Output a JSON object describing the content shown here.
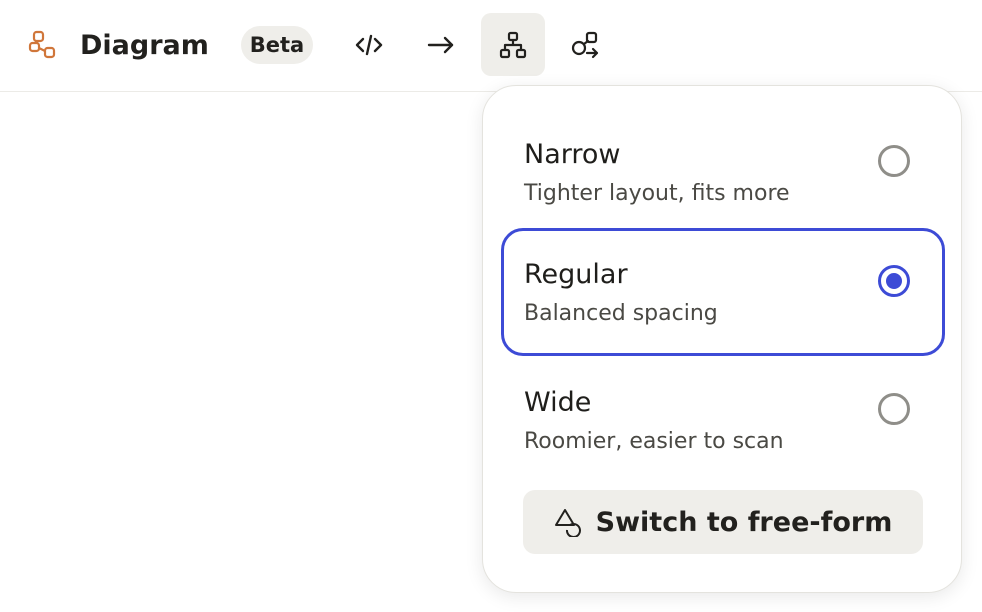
{
  "toolbar": {
    "title": "Diagram",
    "badge": "Beta",
    "logo_icon": "diagram-nodes-icon",
    "buttons": [
      {
        "icon": "code-icon"
      },
      {
        "icon": "arrow-right-icon"
      },
      {
        "icon": "hierarchy-layout-icon",
        "active": true
      },
      {
        "icon": "shapes-connect-icon"
      }
    ]
  },
  "dropdown": {
    "options": [
      {
        "title": "Narrow",
        "description": "Tighter layout, fits more",
        "selected": false
      },
      {
        "title": "Regular",
        "description": "Balanced spacing",
        "selected": true
      },
      {
        "title": "Wide",
        "description": "Roomier, easier to scan",
        "selected": false
      }
    ],
    "switch_label": "Switch to free-form",
    "switch_icon": "shapes-icon"
  },
  "colors": {
    "accent": "#3d4bd6",
    "logo": "#d0763a",
    "button_bg": "#efeeea"
  }
}
